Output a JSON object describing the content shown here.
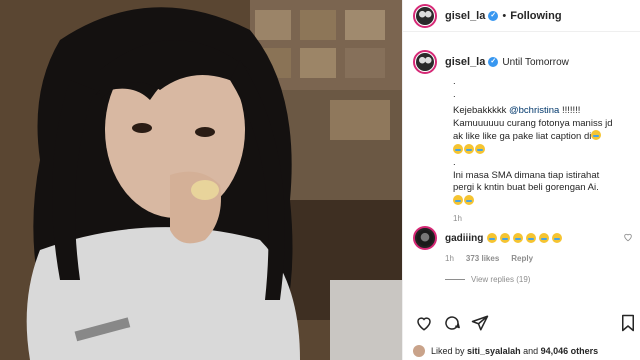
{
  "header": {
    "username": "gisel_la",
    "verified_badge": "✓",
    "separator": "•",
    "follow_state": "Following"
  },
  "caption": {
    "username": "gisel_la",
    "verified_badge": "✓",
    "title": "Until Tomorrow",
    "lines": [
      ".",
      ".",
      "Kejebakkkkk",
      "@bchristina",
      "!!!!!!!",
      "Kamuuuuuu curang fotonya maniss jd",
      "ak like like ga pake liat caption di",
      ".",
      "Ini masa SMA dimana tiap istirahat",
      "pergi k kntin buat beli gorengan Ai."
    ],
    "time": "1h"
  },
  "comment": {
    "username": "gadiiing",
    "time": "1h",
    "likes": "373 likes",
    "reply": "Reply",
    "view_replies": "View replies (19)"
  },
  "likes_bar": {
    "prefix": "Liked by",
    "user": "siti_syalalah",
    "middle": "and",
    "count": "94,046 others"
  },
  "icons": {
    "heart": "heart-icon",
    "comment": "comment-icon",
    "share": "share-icon",
    "bookmark": "bookmark-icon",
    "verified": "verified-badge-icon"
  },
  "colors": {
    "verified_blue": "#3897f0",
    "story_ring": "#d62976",
    "muted_text": "#8e8e8e",
    "mention": "#00376b"
  }
}
